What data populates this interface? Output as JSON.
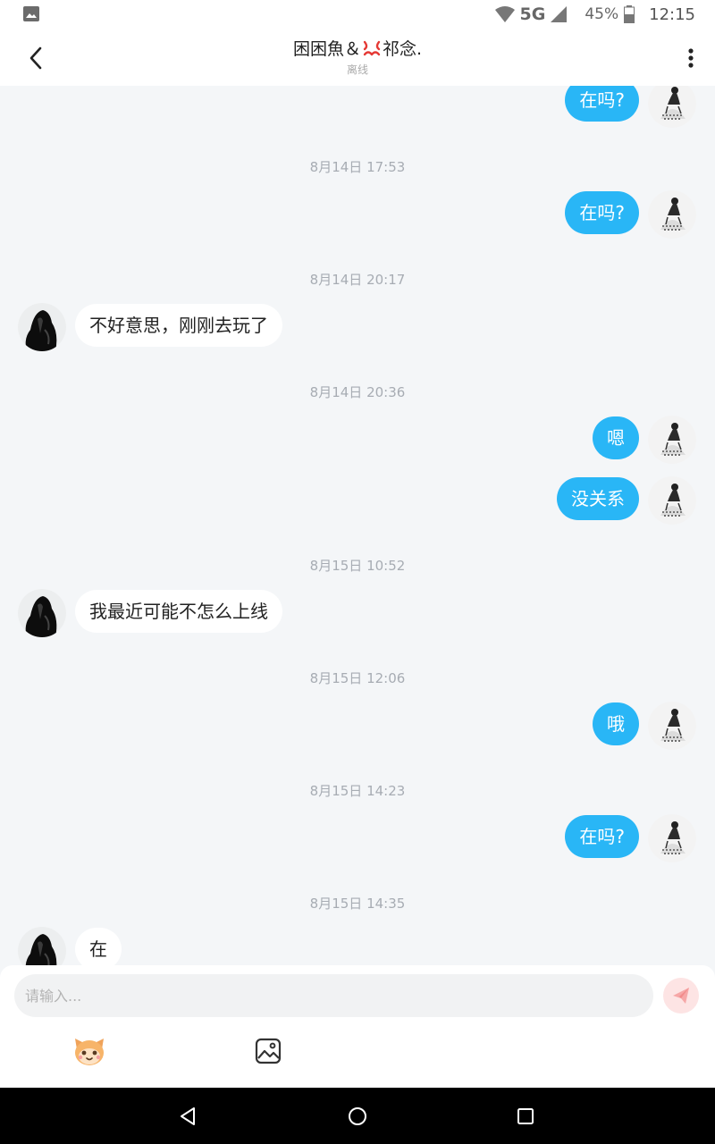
{
  "status_bar": {
    "network": "5G",
    "battery": "45%",
    "time": "12:15"
  },
  "header": {
    "title_prefix": "困困魚＆",
    "title_suffix": "祁念.",
    "status": "离线"
  },
  "messages": [
    {
      "kind": "out",
      "text": "在吗?"
    },
    {
      "kind": "time",
      "text": "8月14日 17:53"
    },
    {
      "kind": "out",
      "text": "在吗?"
    },
    {
      "kind": "time",
      "text": "8月14日 20:17"
    },
    {
      "kind": "in",
      "text": "不好意思，刚刚去玩了"
    },
    {
      "kind": "time",
      "text": "8月14日 20:36"
    },
    {
      "kind": "out",
      "text": "嗯"
    },
    {
      "kind": "out",
      "text": "没关系"
    },
    {
      "kind": "time",
      "text": "8月15日 10:52"
    },
    {
      "kind": "in",
      "text": "我最近可能不怎么上线"
    },
    {
      "kind": "time",
      "text": "8月15日 12:06"
    },
    {
      "kind": "out",
      "text": "哦"
    },
    {
      "kind": "time",
      "text": "8月15日 14:23"
    },
    {
      "kind": "out",
      "text": "在吗?"
    },
    {
      "kind": "time",
      "text": "8月15日 14:35"
    },
    {
      "kind": "in",
      "text": "在"
    }
  ],
  "composer": {
    "placeholder": "请输入..."
  },
  "colors": {
    "outgoing_bubble": "#29b6f6",
    "incoming_bubble": "#ffffff",
    "send_button": "#fde4e4"
  }
}
